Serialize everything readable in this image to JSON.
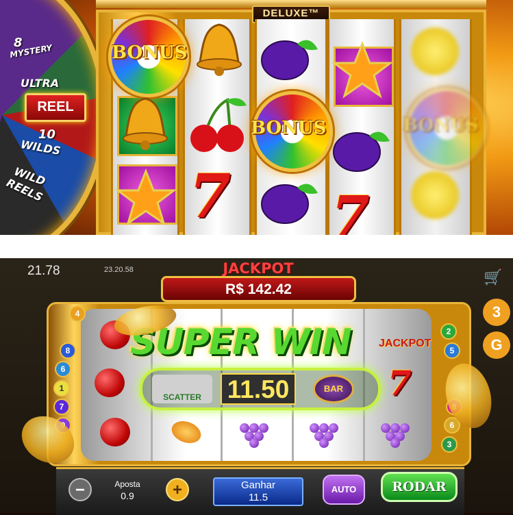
{
  "top_game": {
    "banner": "DELUXE™",
    "wheel_segments": [
      "8",
      "MYSTERY",
      "ULTRA",
      "REEL",
      "10",
      "WILDS",
      "WILD",
      "REELS"
    ],
    "bonus_label": "BONUS"
  },
  "bottom_game": {
    "status": {
      "time": "21.78",
      "clock": "23.20.58"
    },
    "jackpot": {
      "title": "JACKPOT",
      "amount": "R$ 142.42"
    },
    "win_banner": "SUPER WIN",
    "win_amount": "11.50",
    "symbols": {
      "scatter": "SCATTER",
      "bar": "BAR",
      "jackpot": "JACKPOT",
      "seven": "7"
    },
    "left_numbers": [
      "4",
      "8",
      "6",
      "1",
      "7",
      "9"
    ],
    "right_numbers": [
      "2",
      "5",
      "8",
      "6",
      "3"
    ],
    "controls": {
      "minus": "−",
      "plus": "+",
      "bet_label": "Aposta",
      "bet_value": "0.9",
      "win_label": "Ganhar",
      "win_value": "11.5",
      "auto": "AUTO",
      "spin": "RODAR"
    },
    "side_icons": [
      "cart-icon",
      "3",
      "G"
    ]
  }
}
